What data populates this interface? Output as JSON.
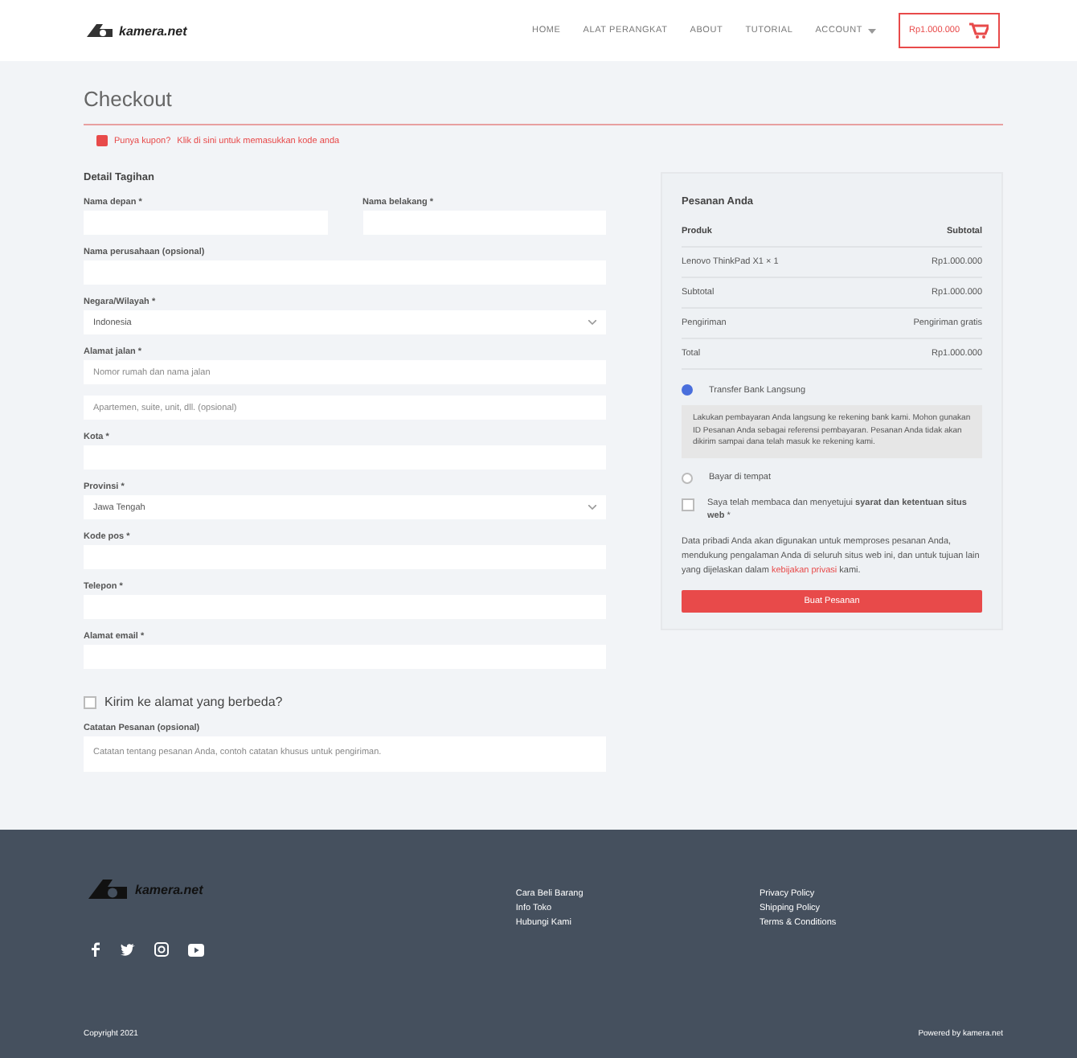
{
  "header": {
    "logo": "kamera.net",
    "nav": [
      {
        "label": "HOME",
        "dropdown": false
      },
      {
        "label": "ALAT PERANGKAT",
        "dropdown": false
      },
      {
        "label": "ABOUT",
        "dropdown": false
      },
      {
        "label": "TUTORIAL",
        "dropdown": false
      },
      {
        "label": "ACCOUNT",
        "dropdown": true
      }
    ],
    "cart": "Rp1.000.000"
  },
  "page_title": "Checkout",
  "coupon_notice": {
    "text": "Punya kupon?",
    "link": "Klik di sini untuk memasukkan kode anda"
  },
  "billing": {
    "title": "Detail Tagihan",
    "name_row": [
      {
        "label": "Nama depan *"
      },
      {
        "label": "Nama belakang *"
      }
    ],
    "fields": [
      {
        "label": "Nama perusahaan (opsional)",
        "kind": "text"
      },
      {
        "label": "Negara/Wilayah *",
        "kind": "select",
        "inputs": [
          {
            "value": "Indonesia"
          }
        ]
      },
      {
        "label": "Alamat jalan *",
        "kind": "text",
        "inputs": [
          {
            "placeholder": "Nomor rumah dan nama jalan"
          },
          {
            "placeholder": "Apartemen, suite, unit, dll. (opsional)"
          }
        ]
      },
      {
        "label": "Kota *",
        "kind": "text"
      },
      {
        "label": "Provinsi *",
        "kind": "select",
        "inputs": [
          {
            "value": "Jawa Tengah"
          }
        ]
      },
      {
        "label": "Kode pos *",
        "kind": "text"
      },
      {
        "label": "Telepon *",
        "kind": "text"
      },
      {
        "label": "Alamat email *",
        "kind": "text"
      }
    ]
  },
  "ship_different": {
    "label": "Kirim ke alamat yang berbeda?",
    "checked": false
  },
  "order_notes": {
    "label": "Catatan Pesanan (opsional)",
    "placeholder": "Catatan tentang pesanan Anda, contoh catatan khusus untuk pengiriman."
  },
  "order": {
    "title": "Pesanan Anda",
    "columns": [
      "Produk",
      "Subtotal"
    ],
    "rows": [
      [
        "Lenovo ThinkPad X1 × 1",
        "Rp1.000.000"
      ],
      [
        "Subtotal",
        "Rp1.000.000"
      ],
      [
        "Pengiriman",
        "Pengiriman gratis"
      ],
      [
        "Total",
        "Rp1.000.000"
      ]
    ],
    "payments": [
      {
        "label": "Transfer Bank Langsung",
        "selected": true,
        "description": "Lakukan pembayaran Anda langsung ke rekening bank kami. Mohon gunakan ID Pesanan Anda sebagai referensi pembayaran. Pesanan Anda tidak akan dikirim sampai dana telah masuk ke rekening kami."
      },
      {
        "label": "Bayar di tempat",
        "selected": false
      }
    ],
    "terms": {
      "text": "Saya telah membaca dan menyetujui **syarat dan ketentuan situs web** *",
      "checked": false
    },
    "privacy": {
      "before": "Data pribadi Anda akan digunakan untuk memproses pesanan Anda, mendukung pengalaman Anda di seluruh situs web ini, dan untuk tujuan lain yang dijelaskan dalam",
      "link": "kebijakan privasi",
      "after": "kami."
    },
    "button": "Buat Pesanan"
  },
  "footer": {
    "logo": "kamera.net",
    "links_1": [
      "Cara Beli Barang",
      "Info Toko",
      "Hubungi Kami"
    ],
    "links_2": [
      "Privacy Policy",
      "Shipping Policy",
      "Terms & Conditions"
    ],
    "social": [
      {
        "kind": "facebook"
      },
      {
        "kind": "twitter"
      },
      {
        "kind": "instagram"
      },
      {
        "kind": "youtube"
      }
    ],
    "copyright": "Copyright 2021",
    "powered": "Powered by kamera.net"
  }
}
